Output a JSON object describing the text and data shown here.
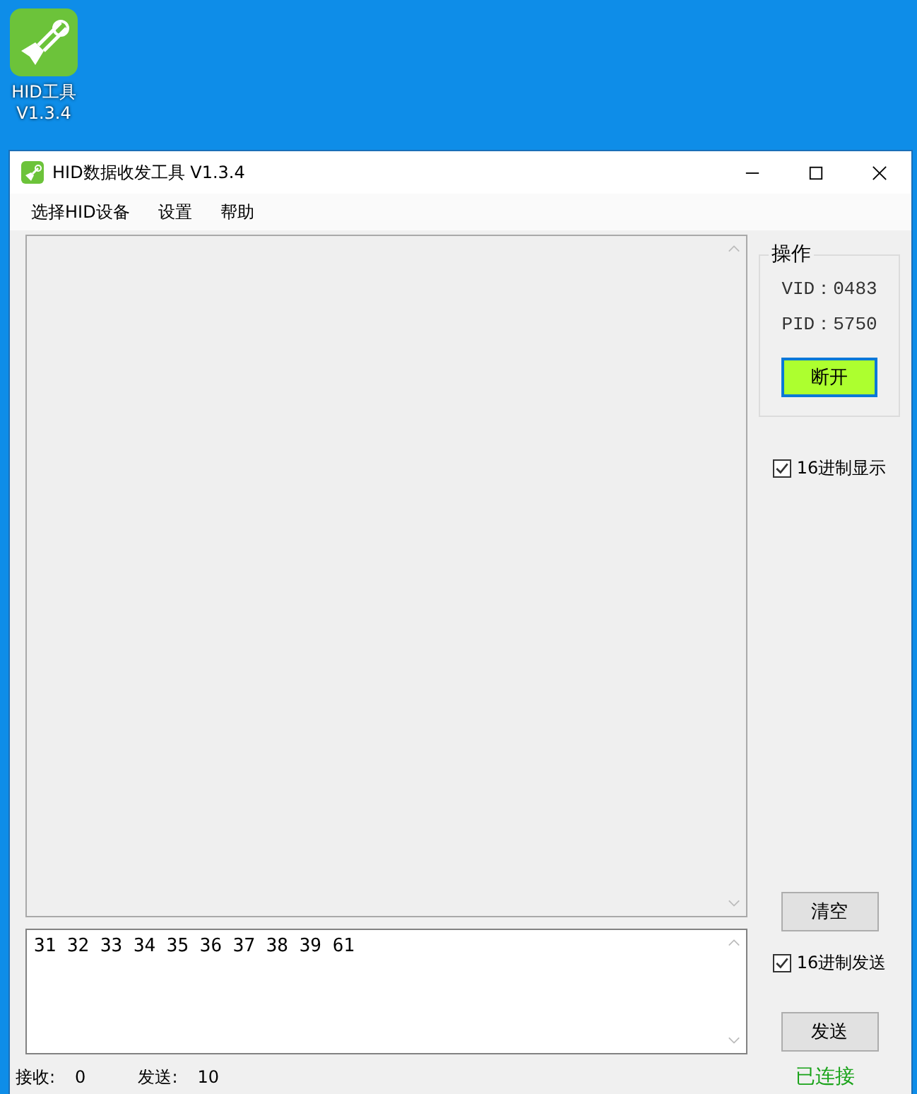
{
  "desktop_icon": {
    "label_lines": [
      "HID工具",
      "V1.3.4"
    ]
  },
  "window": {
    "title": "HID数据收发工具 V1.3.4"
  },
  "menu": [
    "选择HID设备",
    "设置",
    "帮助"
  ],
  "operation_group": {
    "title": "操作",
    "vid": "VID：0483",
    "pid": "PID：5750",
    "button": "断开"
  },
  "hex_display": {
    "label": "16进制显示",
    "checked": true
  },
  "clear_button": "清空",
  "send_area": {
    "value": "31 32 33 34 35 36 37 38 39 61"
  },
  "hex_send": {
    "label": "16进制发送",
    "checked": true
  },
  "send_button": "发送",
  "status_bar": {
    "received_label": "接收:",
    "received": "0",
    "sent_label": "发送:",
    "sent": "10",
    "connection": "已连接",
    "connected": true
  }
}
